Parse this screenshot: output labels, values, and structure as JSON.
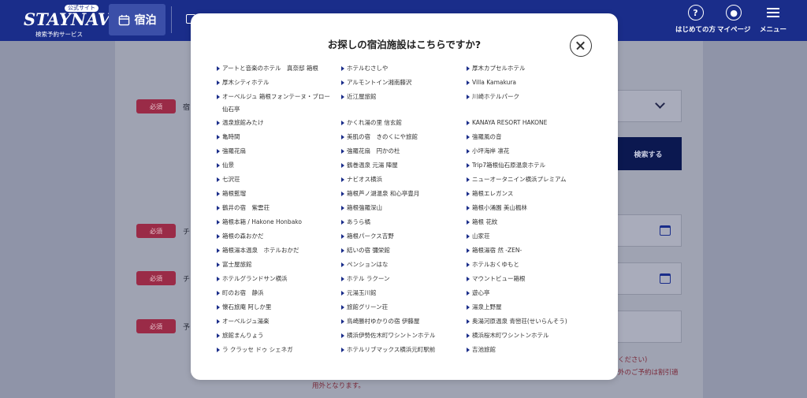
{
  "header": {
    "logo_badge": "公式サイト",
    "logo_main": "STAYNAVI",
    "logo_sub": "検索予約サービス",
    "tab_stay": "宿泊",
    "first_time": "はじめての方",
    "mypage": "マイページ",
    "menu": "メニュー"
  },
  "background": {
    "required": "必須",
    "labels": [
      "宿",
      "チ",
      "チ",
      "予"
    ],
    "search_button": "検索する",
    "note_line1": "ください)",
    "note_line2": "外のご予約は割引適",
    "note_line3": "用外となります。"
  },
  "modal": {
    "title": "お探しの宿泊施設はこちらですか?",
    "columns": [
      [
        "アートと音楽のホテル　真奈邸 箱根",
        "厚木シティホテル",
        "オーベルジュ 箱根フォンテーヌ・ブロー仙石亭",
        "温泉旅館みたけ",
        "亀時間",
        "強羅花扇",
        "仙景",
        "七沢荘",
        "箱根藍瑠",
        "鶴井の宿　紫雲荘",
        "箱根本箱 / Hakone Honbako",
        "箱根の森おかだ",
        "箱根湯本温泉　ホテルおかだ",
        "富士屋旅館",
        "ホテルグランドサン横浜",
        "町のお宿　静浜",
        "懐石旅庵 阿しか里",
        "オーベルジュ湯楽",
        "旅館まんりょう",
        "ラ クラッセ ドゥ シェネガ"
      ],
      [
        "ホテルむさしや",
        "アルモントイン湘南藤沢",
        "近江屋旅館",
        "かくれ湯の里 信玄館",
        "美肌の宿　きのくにや旅館",
        "強羅花扇　円かの杜",
        "鶴巻温泉 元湯 陣屋",
        "ナビオス横浜",
        "箱根芦ノ湖温泉 和心亭豊月",
        "箱根強羅深山",
        "あうら橘",
        "箱根パークス吉野",
        "結いの宿 彌栄館",
        "ペンションはな",
        "ホテル ラクーン",
        "元湯玉川館",
        "旅館グリーン荘",
        "鳥崎勝村ゆかりの宿 伊藤屋",
        "横浜伊勢佐木町ワシントンホテル",
        "ホテルリブマックス横浜元町駅前"
      ],
      [
        "厚木カプセルホテル",
        "Villa Kamakura",
        "川崎ホテルパーク",
        "KANAYA RESORT HAKONE",
        "強羅風の音",
        "小坪海岸 凛花",
        "Trip7箱根仙石原温泉ホテル",
        "ニューオータニイン横浜プレミアム",
        "箱根エレガンス",
        "箱根小涌園 美山楓林",
        "箱根 花紋",
        "山家荘",
        "箱根湯宿 然 -ZEN-",
        "ホテルおくゆもと",
        "マウントビュー箱根",
        "遊心亭",
        "湯泉上野屋",
        "奥湯河原温泉 青巒荘(せいらんそう)",
        "横浜桜木町ワシントンホテル",
        "吉池旅館"
      ]
    ]
  },
  "colors": {
    "brand": "#1a2d8a",
    "required_badge": "#9a2b47",
    "search_button": "#0b1850"
  }
}
